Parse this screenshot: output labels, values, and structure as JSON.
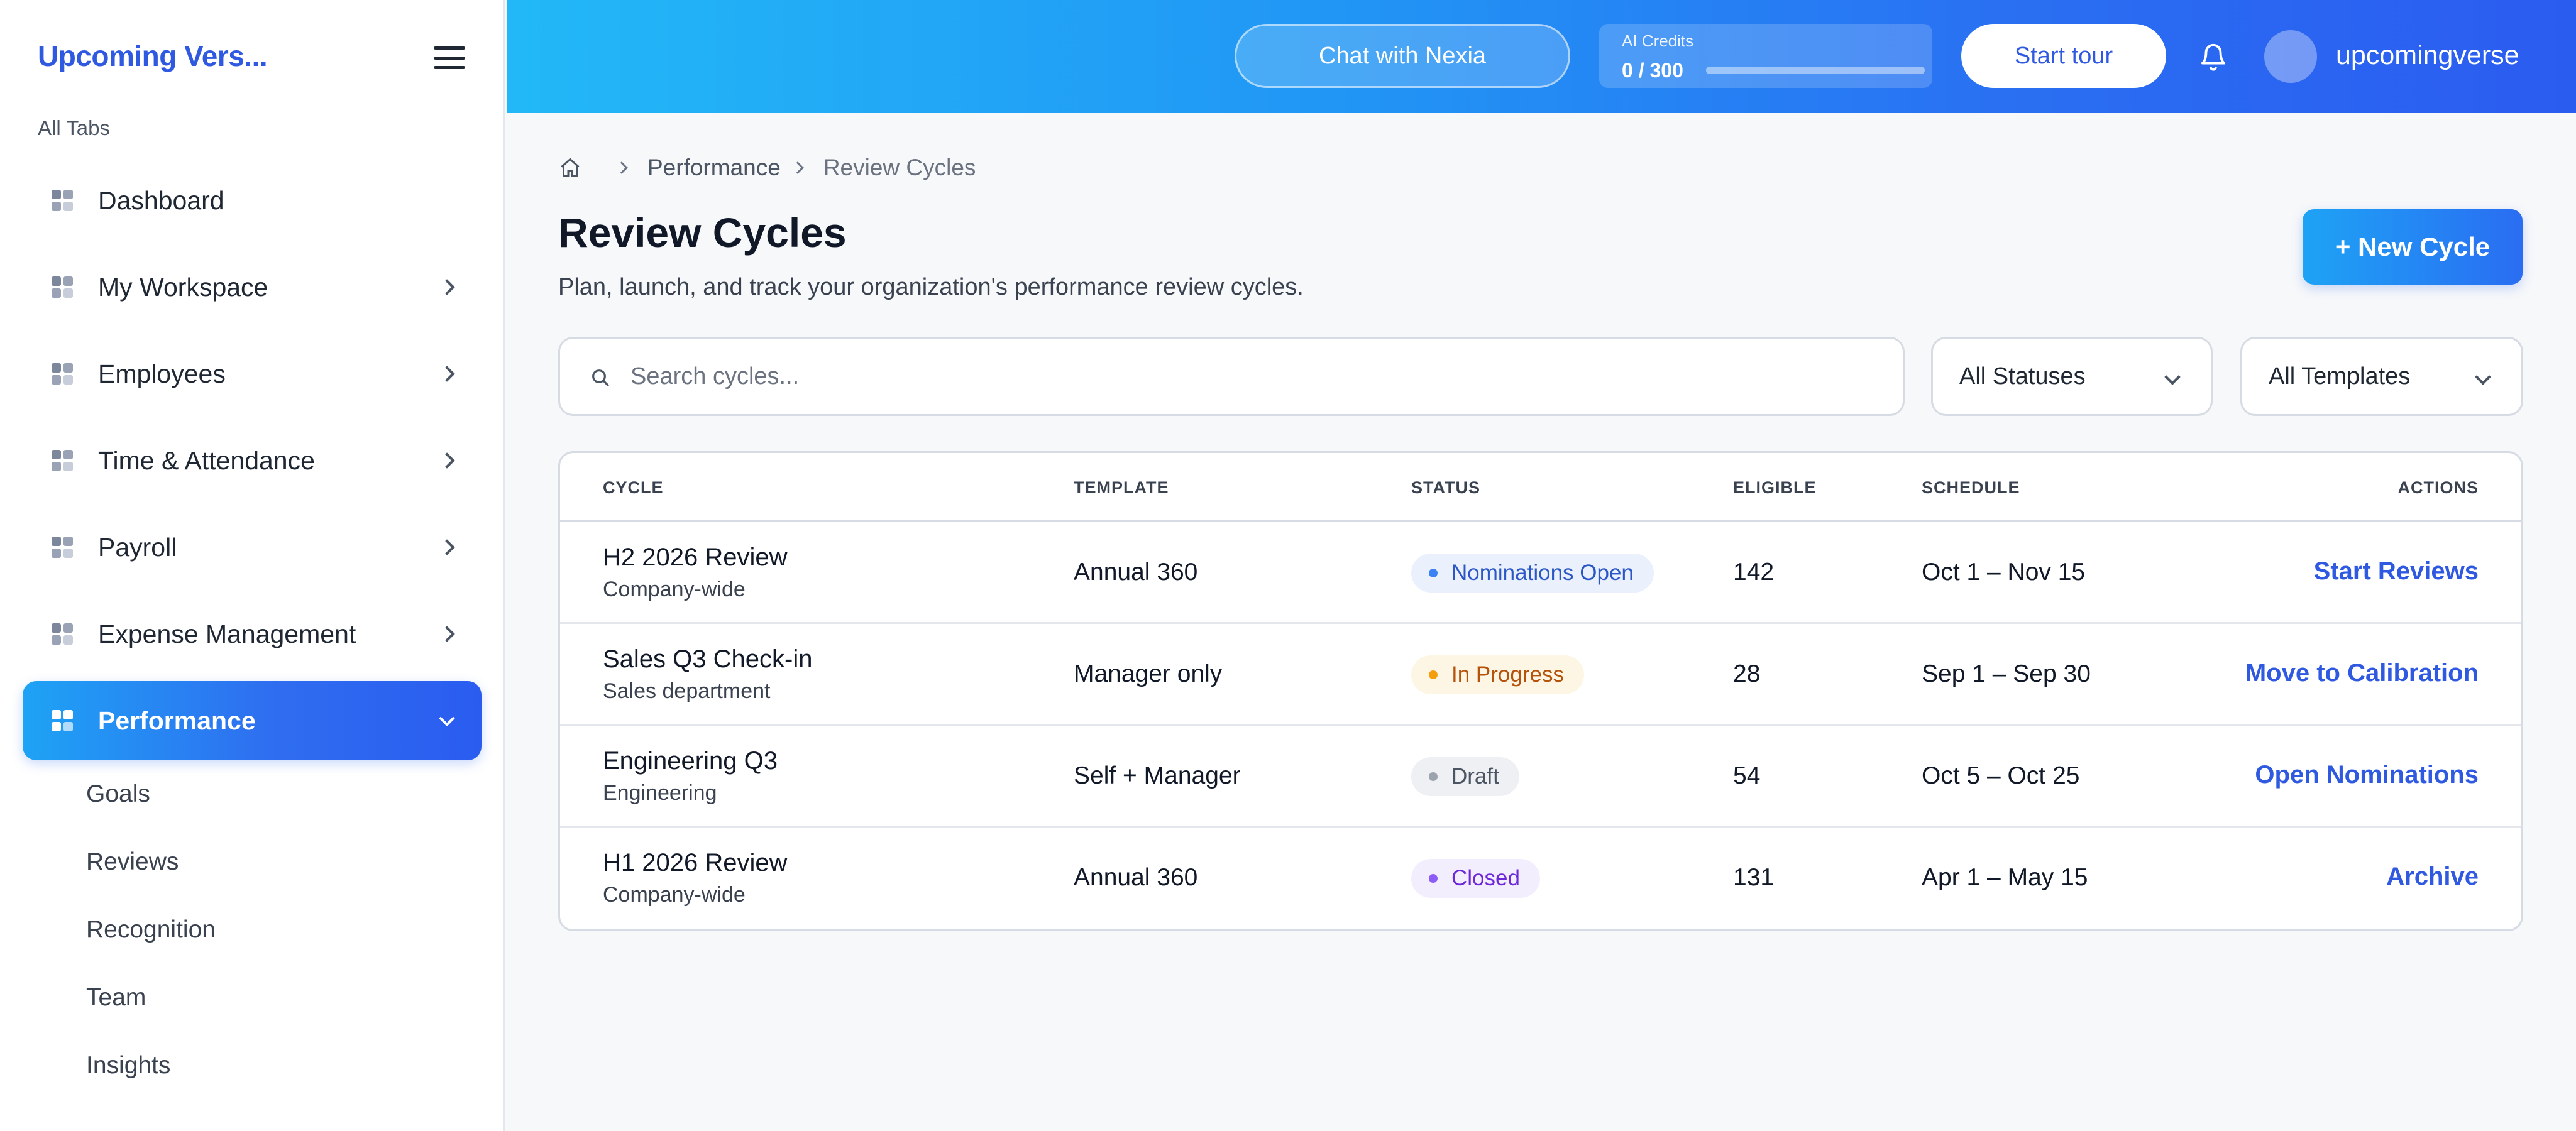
{
  "app": {
    "brand": "Upcoming Vers...",
    "section_label": "All Tabs",
    "user": "upcomingverse"
  },
  "sidebar": {
    "items": [
      {
        "label": "Dashboard",
        "icon": "grid-icon",
        "has_children": false,
        "active": false
      },
      {
        "label": "My Workspace",
        "icon": "grid-icon",
        "has_children": true,
        "active": false
      },
      {
        "label": "Employees",
        "icon": "grid-icon",
        "has_children": true,
        "active": false
      },
      {
        "label": "Time & Attendance",
        "icon": "grid-icon",
        "has_children": true,
        "active": false
      },
      {
        "label": "Payroll",
        "icon": "grid-icon",
        "has_children": true,
        "active": false
      },
      {
        "label": "Expense Management",
        "icon": "grid-icon",
        "has_children": true,
        "active": false
      },
      {
        "label": "Performance",
        "icon": "grid-icon",
        "has_children": true,
        "active": true
      }
    ],
    "subitems": [
      "Goals",
      "Reviews",
      "Recognition",
      "Team",
      "Insights"
    ]
  },
  "topbar": {
    "chat_label": "Chat with Nexia",
    "credits_caption": "AI Credits",
    "credits_value": "0 / 300",
    "credits_used_fraction": 0,
    "tour_label": "Start tour"
  },
  "breadcrumb": {
    "parent": "Performance",
    "current": "Review Cycles"
  },
  "page": {
    "title": "Review Cycles",
    "subtitle": "Plan, launch, and track your organization's performance review cycles.",
    "new_button": "+ New Cycle"
  },
  "filters": {
    "search_placeholder": "Search cycles...",
    "status_selected": "All Statuses",
    "template_selected": "All Templates"
  },
  "table": {
    "headers": [
      "CYCLE",
      "TEMPLATE",
      "STATUS",
      "ELIGIBLE",
      "SCHEDULE",
      "ACTIONS"
    ],
    "rows": [
      {
        "name": "H2 2026 Review",
        "scope": "Company-wide",
        "template": "Annual 360",
        "status": "Nominations Open",
        "eligible": "142",
        "schedule": "Oct 1 – Nov 15",
        "action": "Start Reviews"
      },
      {
        "name": "Sales Q3 Check-in",
        "scope": "Sales department",
        "template": "Manager only",
        "status": "In Progress",
        "eligible": "28",
        "schedule": "Sep 1 – Sep 30",
        "action": "Move to Calibration"
      },
      {
        "name": "Engineering Q3",
        "scope": "Engineering",
        "template": "Self + Manager",
        "status": "Draft",
        "eligible": "54",
        "schedule": "Oct 5 – Oct 25",
        "action": "Open Nominations"
      },
      {
        "name": "H1 2026 Review",
        "scope": "Company-wide",
        "template": "Annual 360",
        "status": "Closed",
        "eligible": "131",
        "schedule": "Apr 1 – May 15",
        "action": "Archive"
      }
    ]
  },
  "colors": {
    "accent": "#2f59e0",
    "status_nominations_open": {
      "bg": "#eaf1fd",
      "dot": "#3b82f6",
      "text": "#2a56c6"
    },
    "status_in_progress": {
      "bg": "#fdf6e4",
      "dot": "#f59e0b",
      "text": "#b45309"
    },
    "status_draft": {
      "bg": "#eef0f3",
      "dot": "#9ca3af",
      "text": "#4b5563"
    },
    "status_closed": {
      "bg": "#f3eefd",
      "dot": "#8b5cf6",
      "text": "#6d28d9"
    }
  }
}
